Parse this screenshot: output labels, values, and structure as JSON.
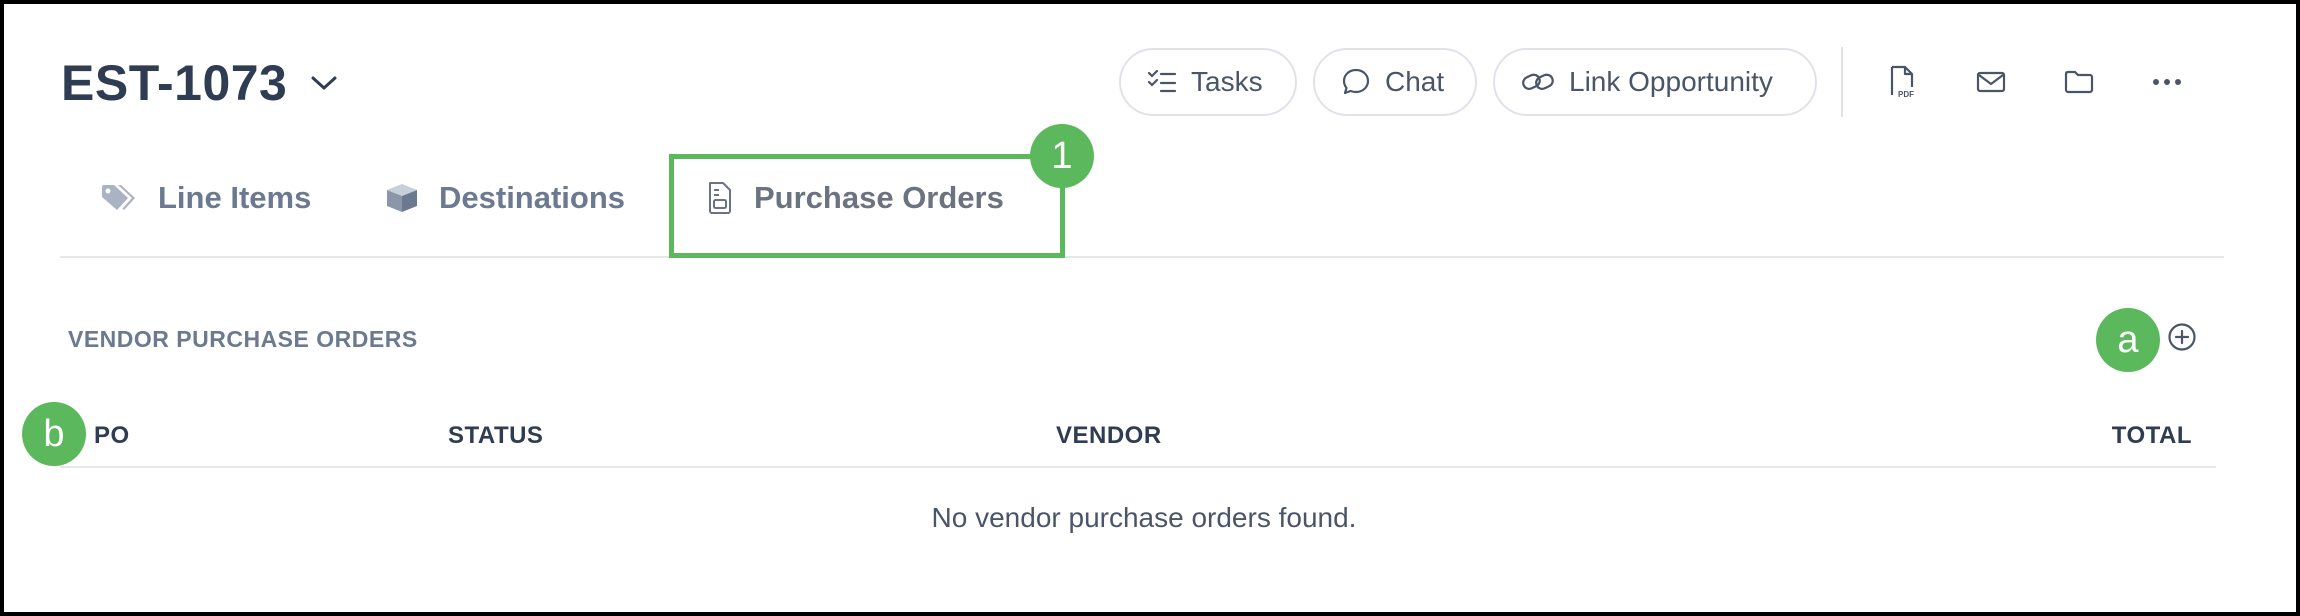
{
  "header": {
    "title": "EST-1073",
    "actions": {
      "tasks_label": "Tasks",
      "chat_label": "Chat",
      "link_label": "Link Opportunity"
    },
    "icon_buttons": [
      "pdf-icon",
      "mail-icon",
      "folder-icon",
      "more-icon"
    ]
  },
  "tabs": [
    {
      "label": "Line Items",
      "icon": "tag-icon"
    },
    {
      "label": "Destinations",
      "icon": "box-icon"
    },
    {
      "label": "Purchase Orders",
      "icon": "document-icon",
      "active": true
    }
  ],
  "annotations": {
    "badge_1": "1",
    "badge_a": "a",
    "badge_b": "b",
    "color": "#5cb85c"
  },
  "section": {
    "title": "VENDOR PURCHASE ORDERS",
    "columns": [
      "PO",
      "STATUS",
      "VENDOR",
      "TOTAL"
    ],
    "rows": [],
    "empty_message": "No vendor purchase orders found."
  }
}
